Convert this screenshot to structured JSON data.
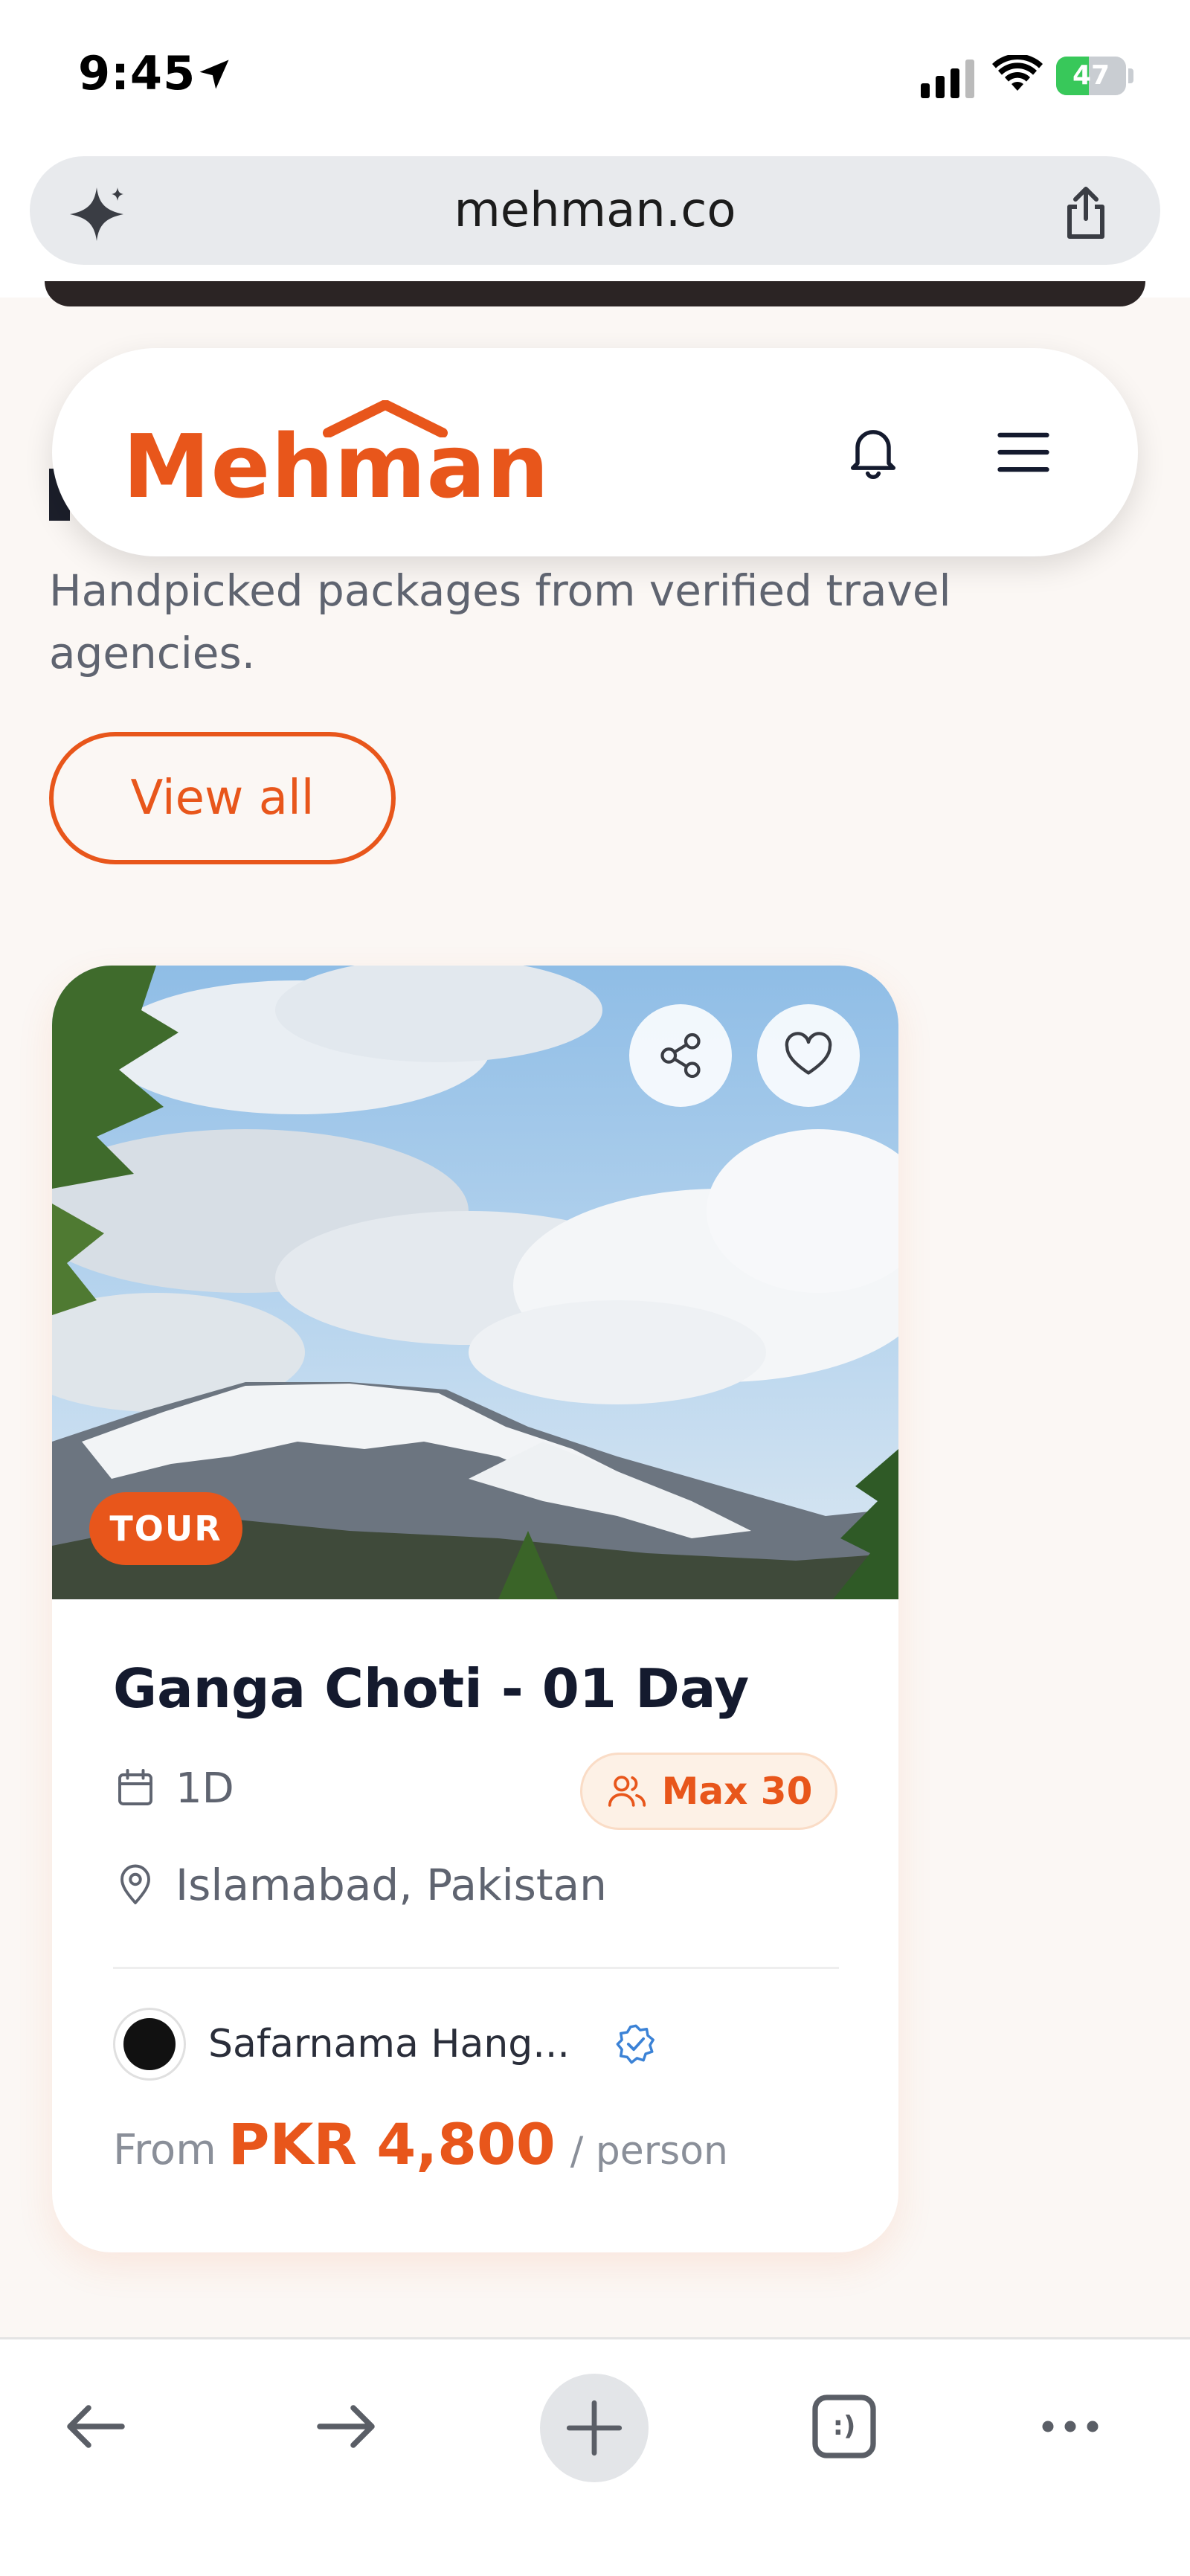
{
  "status_bar": {
    "time": "9:45",
    "battery_percent": "47",
    "battery_level": 0.47,
    "icons": [
      "location-arrow-icon",
      "cellular-signal-icon",
      "wifi-icon",
      "battery-charging-icon"
    ]
  },
  "browser": {
    "url": "mehman.co",
    "icons": [
      "sparkle-icon",
      "share-icon"
    ]
  },
  "header": {
    "logo_text": "Mehman",
    "icons": [
      "bell-icon",
      "hamburger-menu-icon"
    ]
  },
  "section": {
    "subtitle": "Handpicked packages from verified travel agencies.",
    "view_all_label": "View all"
  },
  "card": {
    "badge": "TOUR",
    "title": "Ganga Choti - 01 Day",
    "duration": "1D",
    "max_label": "Max 30",
    "location": "Islamabad, Pakistan",
    "agency_name": "Safarnama Hang...",
    "price_prefix": "From",
    "price": "PKR 4,800",
    "price_unit": "/ person",
    "icons": [
      "share-icon",
      "heart-icon",
      "calendar-icon",
      "people-icon",
      "map-pin-icon",
      "verified-badge-icon"
    ]
  },
  "colors": {
    "brand": "#e8561b",
    "badge_bg": "#fdf1e6",
    "page_bg": "#fbf7f4",
    "text_dark": "#141a2e",
    "text_muted": "#5f6470"
  },
  "toolbar": {
    "new_tab_label": ":)",
    "icons": [
      "back-arrow-icon",
      "forward-arrow-icon",
      "plus-icon",
      "tabs-icon",
      "more-dots-icon"
    ]
  }
}
